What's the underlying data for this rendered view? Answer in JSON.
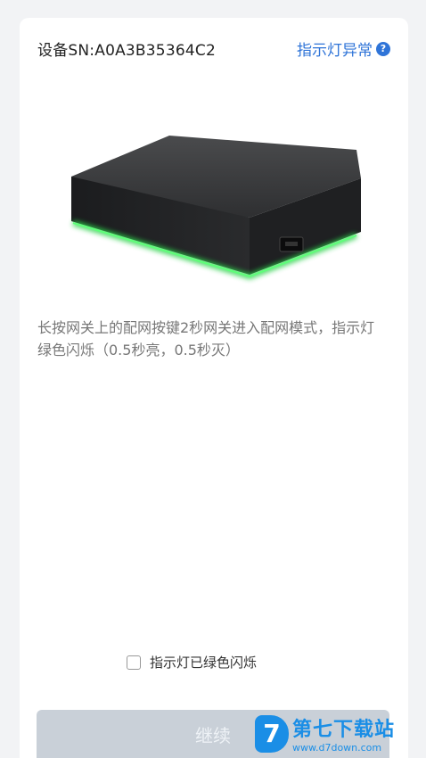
{
  "header": {
    "device_sn": "设备SN:A0A3B35364C2",
    "indicator_abnormal": "指示灯异常",
    "help_symbol": "?"
  },
  "image": {
    "icon": "gateway-device-illustration",
    "glow_color": "#29d04a"
  },
  "instruction": "长按网关上的配网按键2秒网关进入配网模式，指示灯绿色闪烁（0.5秒亮，0.5秒灭）",
  "confirm": {
    "label": "指示灯已绿色闪烁",
    "checked": false
  },
  "continue_button": "继续",
  "watermark": {
    "logo": "7",
    "title": "第七下载站",
    "url": "www.d7down.com"
  },
  "colors": {
    "accent": "#2f74d8",
    "button_disabled": "#c9d0d8"
  }
}
